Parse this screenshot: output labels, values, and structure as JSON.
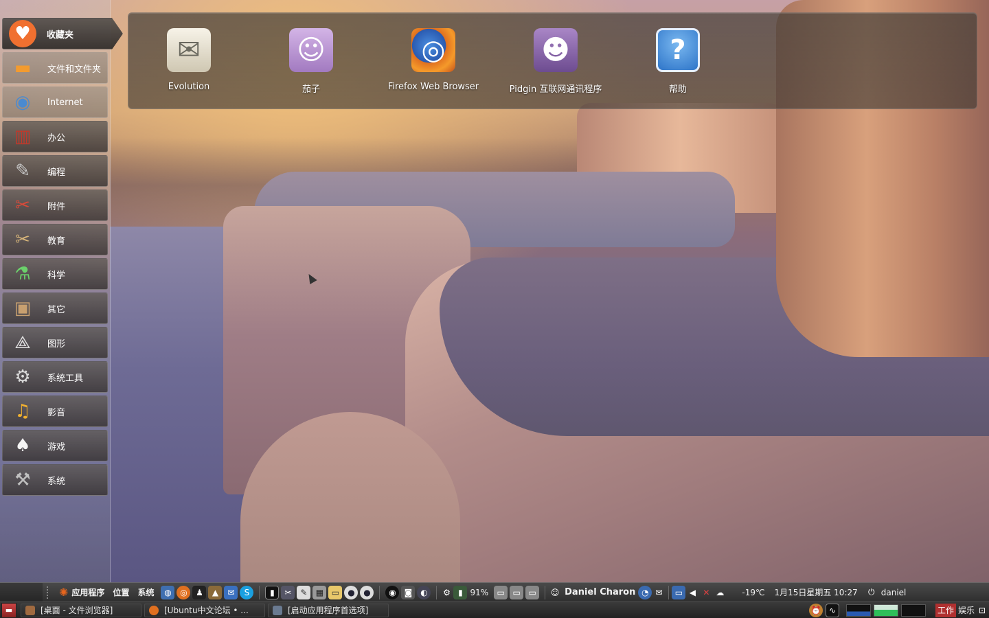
{
  "sidebar": {
    "items": [
      {
        "label": "收藏夹",
        "icon": "heart-icon",
        "glyph": "♥",
        "color": "#f07030"
      },
      {
        "label": "文件和文件夹",
        "icon": "folder-icon",
        "glyph": "▬",
        "color": "#f39b2f"
      },
      {
        "label": "Internet",
        "icon": "globe-icon",
        "glyph": "◉",
        "color": "#4a8ad0"
      },
      {
        "label": "办公",
        "icon": "binders-icon",
        "glyph": "▥",
        "color": "#c0392b"
      },
      {
        "label": "编程",
        "icon": "trowel-icon",
        "glyph": "✎",
        "color": "#c8c8c8"
      },
      {
        "label": "附件",
        "icon": "swiss-knife-icon",
        "glyph": "✂",
        "color": "#d84a3a"
      },
      {
        "label": "教育",
        "icon": "ruler-scissors-icon",
        "glyph": "✂",
        "color": "#d6b47a"
      },
      {
        "label": "科学",
        "icon": "flask-icon",
        "glyph": "⚗",
        "color": "#6bd16b"
      },
      {
        "label": "其它",
        "icon": "box-icon",
        "glyph": "▣",
        "color": "#c8a070"
      },
      {
        "label": "图形",
        "icon": "compass-icon",
        "glyph": "⟁",
        "color": "#e0e0e0"
      },
      {
        "label": "系统工具",
        "icon": "gear-icon",
        "glyph": "⚙",
        "color": "#dcdcdc"
      },
      {
        "label": "影音",
        "icon": "music-icon",
        "glyph": "♫",
        "color": "#f0b030"
      },
      {
        "label": "游戏",
        "icon": "cards-icon",
        "glyph": "♠",
        "color": "#f5f5f5"
      },
      {
        "label": "系统",
        "icon": "tools-icon",
        "glyph": "⚒",
        "color": "#c0c0c0"
      }
    ]
  },
  "favorites": [
    {
      "name": "Evolution",
      "icon": "mail-icon",
      "glyph": "✉"
    },
    {
      "name": "茄子",
      "icon": "webcam-icon",
      "glyph": "☺"
    },
    {
      "name": "Firefox Web Browser",
      "icon": "firefox-icon",
      "glyph": "◎"
    },
    {
      "name": "Pidgin 互联网通讯程序",
      "icon": "pidgin-icon",
      "glyph": "☻"
    },
    {
      "name": "帮助",
      "icon": "help-icon",
      "glyph": "?"
    }
  ],
  "top_panel": {
    "menus": [
      "应用程序",
      "位置",
      "系统"
    ],
    "battery": "91%",
    "user_full": "Daniel Charon",
    "temperature": "-19℃",
    "datetime": "1月15日星期五 10:27",
    "user": "daniel"
  },
  "taskbar": {
    "tasks": [
      {
        "label": "[桌面 - 文件浏览器]",
        "color": "#a06a40"
      },
      {
        "label": "[Ubuntu中文论坛 • ...",
        "color": "#e07020"
      },
      {
        "label": "[启动应用程序首选项]",
        "color": "#6a7a90"
      }
    ],
    "workspaces": [
      "工作",
      "娱乐"
    ]
  }
}
